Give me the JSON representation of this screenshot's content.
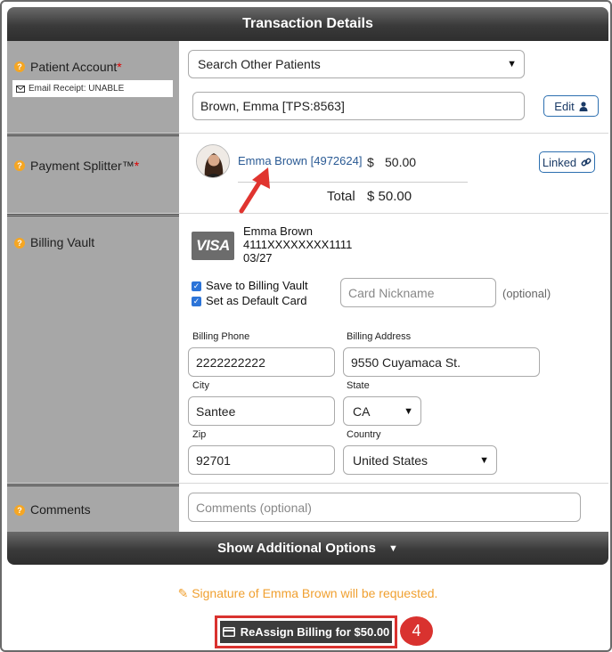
{
  "header": {
    "title": "Transaction Details"
  },
  "patient_account": {
    "label": "Patient Account",
    "required_mark": "*",
    "email_receipt": "Email Receipt: UNABLE",
    "search_select": "Search Other Patients",
    "patient_value": "Brown, Emma [TPS:8563]",
    "edit_label": "Edit"
  },
  "payment_splitter": {
    "label": "Payment Splitter™",
    "required_mark": "*",
    "patient_link": "Emma Brown [4972624]",
    "currency": "$",
    "amount": "50.00",
    "total_label": "Total",
    "total_value": "$ 50.00",
    "linked_label": "Linked"
  },
  "billing_vault": {
    "label": "Billing Vault",
    "card_brand": "VISA",
    "card_name": "Emma Brown",
    "card_number": "4111XXXXXXXX1111",
    "card_expiry": "03/27",
    "save_to_vault": "Save to Billing Vault",
    "set_default": "Set as Default Card",
    "nickname_placeholder": "Card Nickname",
    "nickname_hint": "(optional)",
    "billing_phone_label": "Billing Phone",
    "billing_phone": "2222222222",
    "billing_address_label": "Billing Address",
    "billing_address": "9550 Cuyamaca St.",
    "city_label": "City",
    "city": "Santee",
    "state_label": "State",
    "state": "CA",
    "zip_label": "Zip",
    "zip": "92701",
    "country_label": "Country",
    "country": "United States"
  },
  "comments": {
    "label": "Comments",
    "placeholder": "Comments (optional)"
  },
  "footer": {
    "show_more": "Show Additional Options",
    "signature_note": "Signature of Emma Brown will be requested.",
    "reassign_button": "ReAssign Billing for $50.00",
    "step_number": "4"
  },
  "colors": {
    "accent_red": "#d9322f",
    "help_orange": "#f5a623",
    "link_blue": "#2a5a94"
  }
}
